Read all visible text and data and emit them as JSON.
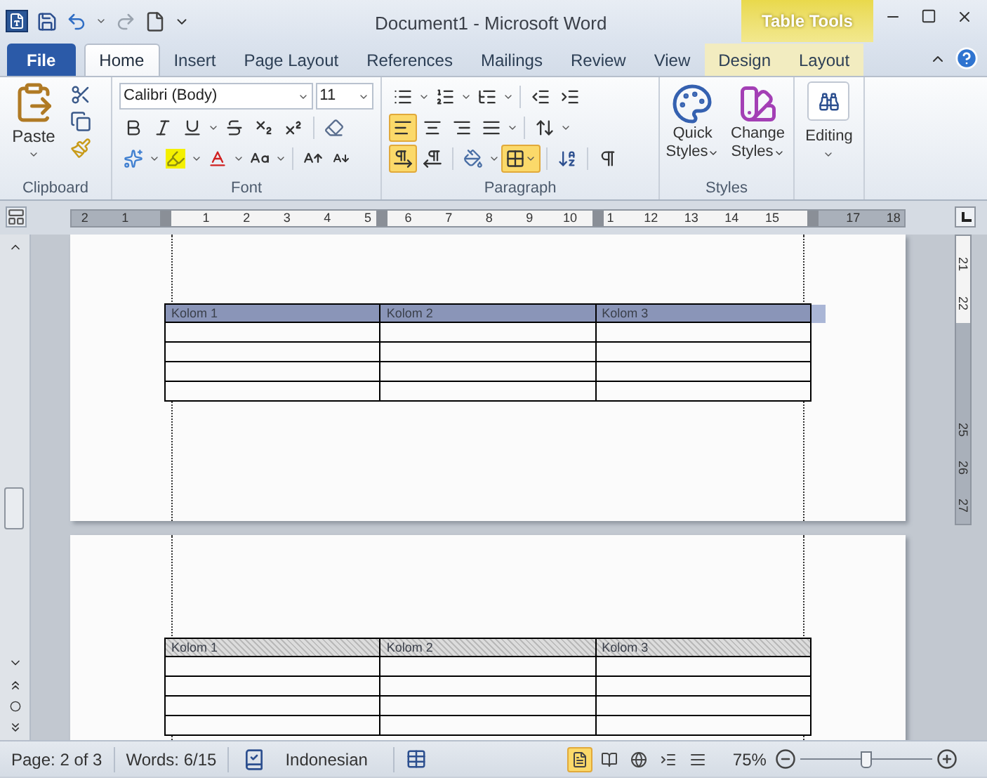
{
  "window": {
    "title": "Document1 - Microsoft Word",
    "contextual_group": "Table Tools"
  },
  "tabs": [
    {
      "label": "File",
      "kind": "file",
      "selected": false
    },
    {
      "label": "Home",
      "kind": "normal",
      "selected": true
    },
    {
      "label": "Insert",
      "kind": "normal",
      "selected": false
    },
    {
      "label": "Page Layout",
      "kind": "normal",
      "selected": false
    },
    {
      "label": "References",
      "kind": "normal",
      "selected": false
    },
    {
      "label": "Mailings",
      "kind": "normal",
      "selected": false
    },
    {
      "label": "Review",
      "kind": "normal",
      "selected": false
    },
    {
      "label": "View",
      "kind": "normal",
      "selected": false
    },
    {
      "label": "Design",
      "kind": "contextual",
      "selected": false
    },
    {
      "label": "Layout",
      "kind": "contextual",
      "selected": false
    }
  ],
  "ribbon": {
    "clipboard": {
      "label": "Clipboard",
      "paste": "Paste"
    },
    "font": {
      "label": "Font",
      "font_name": "Calibri (Body)",
      "font_size": "11"
    },
    "paragraph": {
      "label": "Paragraph",
      "alignment": [
        {
          "selected": true
        },
        {
          "selected": false
        },
        {
          "selected": false
        },
        {
          "selected": false
        }
      ],
      "direction": [
        {
          "selected": true
        },
        {
          "selected": false
        }
      ],
      "borders_selected": true
    },
    "styles": {
      "label": "Styles",
      "quick_styles": [
        "Quick",
        "Styles"
      ],
      "change_styles": [
        "Change",
        "Styles"
      ]
    },
    "editing": {
      "label": "Editing"
    }
  },
  "ruler": {
    "horizontal": [
      "2",
      "1",
      "1",
      "2",
      "3",
      "4",
      "5",
      "6",
      "7",
      "8",
      "9",
      "10",
      "1",
      "12",
      "13",
      "14",
      "15",
      "17",
      "18"
    ],
    "vertical": [
      "21",
      "22",
      "25",
      "26",
      "27"
    ]
  },
  "pages": [
    {
      "table": {
        "columns": [
          "Kolom 1",
          "Kolom 2",
          "Kolom 3"
        ],
        "header_selected": true
      }
    },
    {
      "table": {
        "columns": [
          "Kolom 1",
          "Kolom 2",
          "Kolom 3"
        ],
        "header_selected": false
      }
    }
  ],
  "status_bar": {
    "page": "Page: 2 of 3",
    "words": "Words: 6/15",
    "language": "Indonesian",
    "views": [
      {
        "selected": true
      },
      {
        "selected": false
      },
      {
        "selected": false
      },
      {
        "selected": false
      },
      {
        "selected": false
      }
    ],
    "zoom": "75%",
    "zoom_slider": {
      "level": 0.5
    }
  }
}
